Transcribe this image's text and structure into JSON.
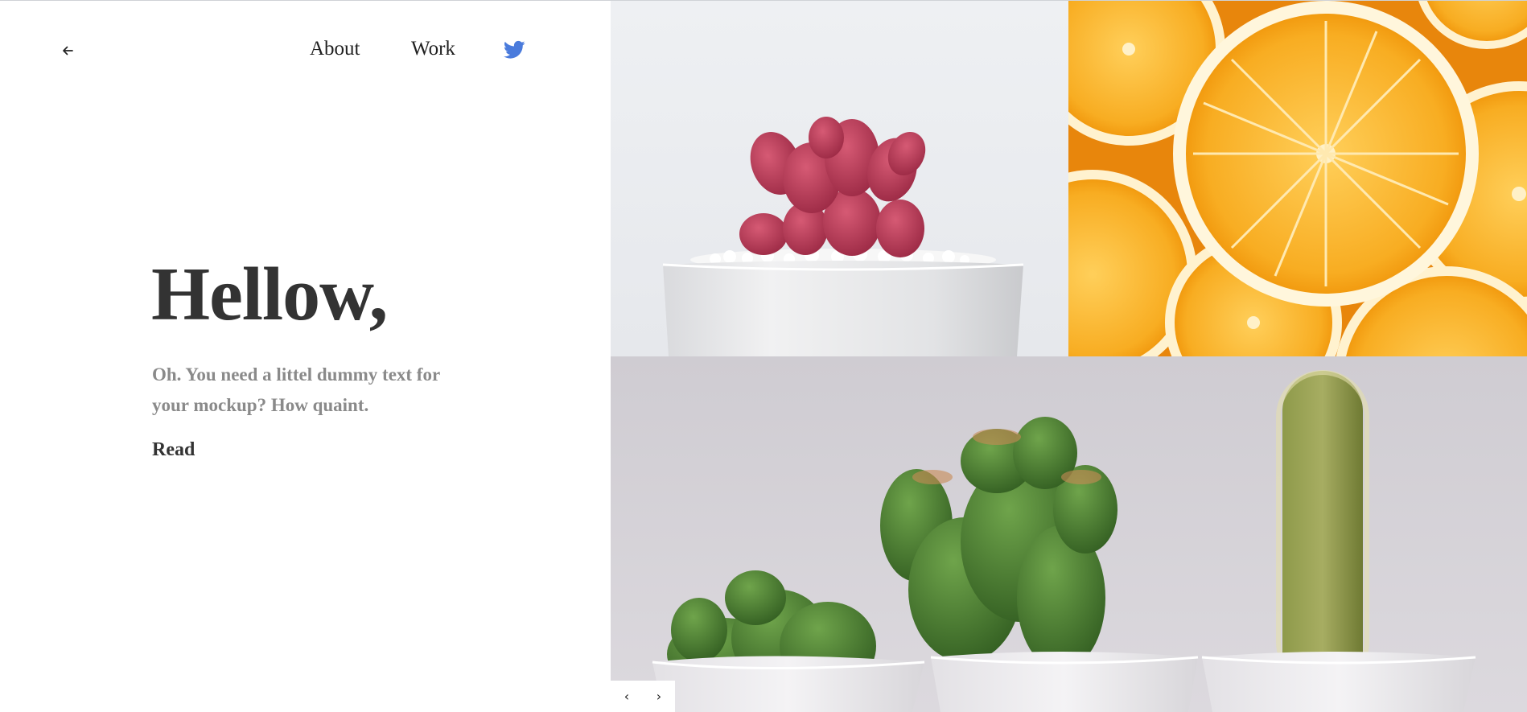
{
  "nav": {
    "back_icon": "arrow-left-icon",
    "links": [
      {
        "label": "About"
      },
      {
        "label": "Work"
      }
    ],
    "social_icon": "twitter-icon",
    "social_color": "#4a7bdc"
  },
  "hero": {
    "title": "Hellow,",
    "subtitle": "Oh. You need a littel dummy text for your mockup? How quaint.",
    "cta": "Read"
  },
  "gallery": {
    "tiles": [
      {
        "subject": "pink-cactus-in-white-pot-photo"
      },
      {
        "subject": "orange-slices-photo"
      },
      {
        "subject": "three-cacti-in-white-pots-photo"
      }
    ],
    "pager": {
      "prev": "‹",
      "next": "›"
    }
  },
  "colors": {
    "title": "#333333",
    "subtitle": "#8a8a8a",
    "accent": "#4a7bdc"
  }
}
